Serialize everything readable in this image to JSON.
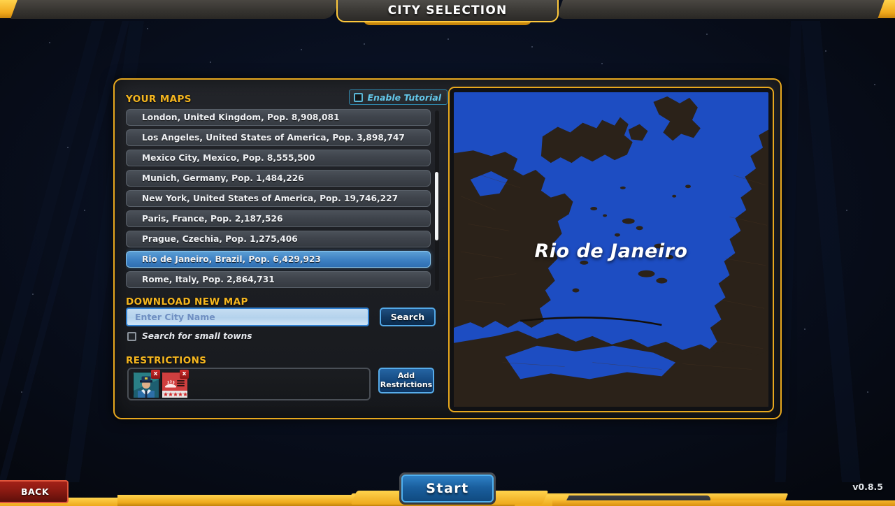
{
  "window": {
    "title": "CITY SELECTION",
    "version": "v0.8.5"
  },
  "colors": {
    "gold": "#e8a81e",
    "panel_bg": "#1d1f24",
    "selected_row": "#3f82c4",
    "map_water": "#1d4dc2",
    "map_land": "#2b2219",
    "back_red": "#8a1a12",
    "start_blue": "#1a5f9e",
    "tutorial_cyan": "#63c6e8"
  },
  "left_panel": {
    "your_maps_title": "YOUR MAPS",
    "tutorial": {
      "label": "Enable Tutorial",
      "checked": false,
      "checkbox_icon": "checkbox-unchecked-icon"
    },
    "maps": [
      {
        "label": "London, United Kingdom, Pop. 8,908,081",
        "selected": false
      },
      {
        "label": "Los Angeles, United States of America, Pop. 3,898,747",
        "selected": false
      },
      {
        "label": "Mexico City, Mexico, Pop. 8,555,500",
        "selected": false
      },
      {
        "label": "Munich, Germany, Pop. 1,484,226",
        "selected": false
      },
      {
        "label": "New York, United States of America, Pop. 19,746,227",
        "selected": false
      },
      {
        "label": "Paris, France, Pop. 2,187,526",
        "selected": false
      },
      {
        "label": "Prague, Czechia, Pop. 1,275,406",
        "selected": false
      },
      {
        "label": "Rio de Janeiro, Brazil, Pop. 6,429,923",
        "selected": true
      },
      {
        "label": "Rome, Italy, Pop. 2,864,731",
        "selected": false
      }
    ],
    "download": {
      "title": "DOWNLOAD NEW MAP",
      "input_value": "",
      "input_placeholder": "Enter City Name",
      "search_label": "Search",
      "small_towns": {
        "label": "Search for small towns",
        "checked": false,
        "checkbox_icon": "checkbox-unchecked-icon"
      }
    },
    "restrictions": {
      "title": "RESTRICTIONS",
      "add_label": "Add\nRestrictions",
      "add_label_line1": "Add",
      "add_label_line2": "Restrictions",
      "chips": [
        {
          "icon": "police-officer-icon",
          "remove_icon": "close-icon",
          "remove_label": "x"
        },
        {
          "icon": "restaurant-rating-icon",
          "remove_icon": "close-icon",
          "remove_label": "x"
        }
      ]
    }
  },
  "map_preview": {
    "city_name": "Rio de Janeiro",
    "water_color": "#1d4dc2",
    "land_color": "#2b2219"
  },
  "footer": {
    "back_label": "BACK",
    "start_label": "Start",
    "version_label": "v0.8.5"
  }
}
